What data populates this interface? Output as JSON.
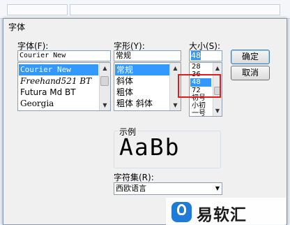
{
  "dialog": {
    "title": "字体",
    "font_label": "字体(F):",
    "style_label": "字形(Y):",
    "size_label": "大小(S):",
    "font_value": "Courier New",
    "style_value": "常规",
    "size_value": "48",
    "fonts": [
      "Courier New",
      "Freehand521 BT",
      "Futura Md BT",
      "Georgia"
    ],
    "styles": [
      "常规",
      "斜体",
      "粗体",
      "粗体 斜体"
    ],
    "sizes": [
      "28",
      "36",
      "48",
      "72",
      "初号",
      "小初",
      "一号"
    ],
    "ok_label": "确定",
    "cancel_label": "取消",
    "sample_label": "示例",
    "sample_text": "AaBb",
    "charset_label": "字符集(R):",
    "charset_value": "西欧语言"
  },
  "watermark": {
    "text": "易软汇"
  }
}
